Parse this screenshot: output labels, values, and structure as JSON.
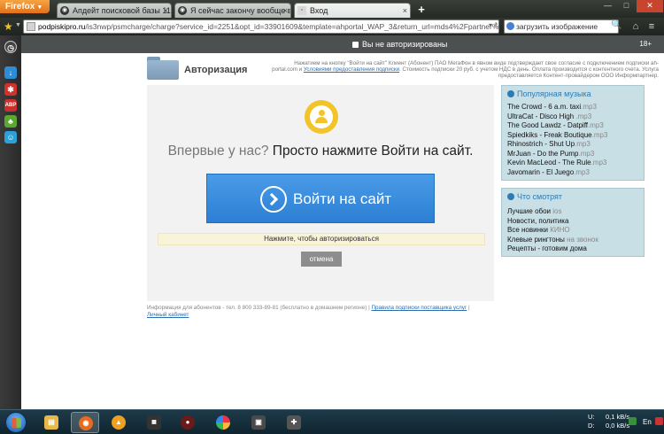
{
  "browser": {
    "menu_button": "Firefox",
    "tabs": [
      {
        "label": "Апдейт поисковой базы 11.0...",
        "active": false
      },
      {
        "label": "Я сейчас закончу вообще вс...",
        "active": false
      },
      {
        "label": "Вход",
        "active": true
      }
    ],
    "new_tab": "+",
    "url": {
      "host": "podpiskipro.ru",
      "path": "/is3nwp/psmcharge/charge?service_id=2251&opt_id=33901609&template=ahportal_WAP_3&return_url=mds4%2Fpartner%"
    },
    "search_value": "загрузить изображение"
  },
  "notification": {
    "message": "Вы не авторизированы",
    "age_rating": "18+"
  },
  "page": {
    "auth_title": "Авторизация",
    "disclaimer": {
      "part1": "Нажатием на кнопку \"Войти на сайт\" Клиент (Абонент) ПАО МегаФон в явном виде подтверждает свое согласие с подключением подписки ah-portal.com и ",
      "link": "Условиями предоставления подписки",
      "part2": ". Стоимость подписки 20 руб. с учетом НДС в день. Оплата производится с контентного счета. Услуга предоставляется Контент-провайдером ООО Информпартнер."
    },
    "headline_question": "Впервые у нас?",
    "headline_answer": "Просто нажмите Войти на сайт.",
    "login_button": "Войти на сайт",
    "hint": "Нажмите, чтобы авторизироваться",
    "cancel_button": "отмена",
    "footer": {
      "info": "Информация для абонентов - тел. 8 800 333-89-81 (бесплатно в домашнем регионе) | ",
      "rules_link": "Правила подписки поставщика услуг",
      "sep": " | ",
      "cabinet_link": "Личный кабинет"
    }
  },
  "sidebar": {
    "popular_music": {
      "title": "Популярная музыка",
      "items": [
        {
          "name": "The Crowd - 6 a.m. taxi",
          "ext": ".mp3"
        },
        {
          "name": "UltraCat - Disco High ",
          "ext": ".mp3"
        },
        {
          "name": "The Good Lawdz - Datpiff",
          "ext": ".mp3"
        },
        {
          "name": "Spiedkiks - Freak Boutique",
          "ext": ".mp3"
        },
        {
          "name": "Rhinostrich - Shut Up",
          "ext": ".mp3"
        },
        {
          "name": "MrJuan - Do the Pump",
          "ext": ".mp3"
        },
        {
          "name": "Kevin MacLeod - The Rule",
          "ext": ".mp3"
        },
        {
          "name": "Javomarin - El Juego",
          "ext": ".mp3"
        }
      ]
    },
    "trending": {
      "title": "Что смотрят",
      "items": [
        {
          "name": "Лучшие обои ",
          "ext": "ios"
        },
        {
          "name": "Новости, политика",
          "ext": ""
        },
        {
          "name": "Все новинки ",
          "ext": "КИНО"
        },
        {
          "name": "Клевые рингтоны ",
          "ext": "на звонок"
        },
        {
          "name": "Рецепты - готовим дома",
          "ext": ""
        }
      ]
    }
  },
  "taskbar": {
    "tray": {
      "up_label": "U:",
      "up_value": "0,1 kB/s",
      "down_label": "D:",
      "down_value": "0,0 kB/s",
      "language": "En"
    }
  },
  "colors": {
    "accent_blue": "#2c7fd3",
    "badge_yellow": "#f2c42a",
    "side_box_bg": "#c8dfe6"
  }
}
